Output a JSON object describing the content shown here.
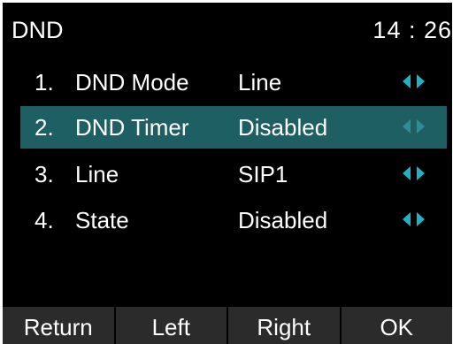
{
  "header": {
    "title": "DND",
    "time": "14 : 26"
  },
  "menu": {
    "selected_index": 1,
    "accent_color": "#1fb2c6",
    "highlight_color": "#1d5f63",
    "items": [
      {
        "number": "1.",
        "label": "DND Mode",
        "value": "Line"
      },
      {
        "number": "2.",
        "label": "DND Timer",
        "value": "Disabled"
      },
      {
        "number": "3.",
        "label": "Line",
        "value": "SIP1"
      },
      {
        "number": "4.",
        "label": "State",
        "value": "Disabled"
      }
    ]
  },
  "softkeys": {
    "return_label": "Return",
    "left_label": "Left",
    "right_label": "Right",
    "ok_label": "OK"
  }
}
